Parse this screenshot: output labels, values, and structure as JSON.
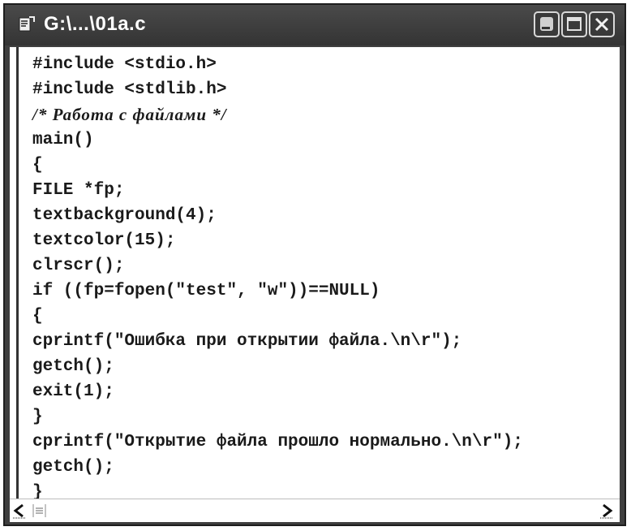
{
  "window": {
    "title": "G:\\...\\01a.c",
    "icons": {
      "app": "source-file-icon",
      "minimize": "minimize-icon",
      "maximize": "maximize-icon",
      "close": "close-icon"
    }
  },
  "editor": {
    "lines": [
      "#include <stdio.h>",
      "#include <stdlib.h>",
      "/* Работа с файлами */",
      "main()",
      "{",
      "FILE *fp;",
      "textbackground(4);",
      "textcolor(15);",
      "clrscr();",
      "if ((fp=fopen(\"test\", \"w\"))==NULL)",
      "{",
      "cprintf(\"Ошибка при открытии файла.\\n\\r\");",
      "getch();",
      "exit(1);",
      "}",
      "cprintf(\"Открытие файла прошло нормально.\\n\\r\");",
      "getch();",
      "}"
    ]
  },
  "statusbar": {
    "icons": {
      "left": "scroll-left-icon",
      "list": "list-view-icon",
      "right": "scroll-right-icon"
    }
  }
}
